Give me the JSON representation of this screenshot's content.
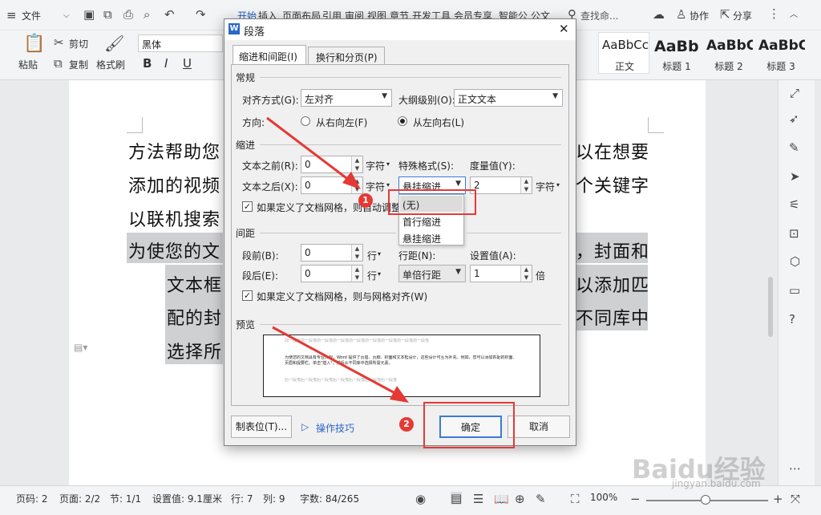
{
  "menubar": {
    "file": "文件",
    "tabs": [
      "开始",
      "插入",
      "页面布局",
      "引用",
      "审阅",
      "视图",
      "章节",
      "开发工具",
      "会员专享",
      "智能公",
      "公文"
    ],
    "search": "查找命...",
    "collab": "协作",
    "share": "分享"
  },
  "ribbon": {
    "paste": "粘贴",
    "cut": "剪切",
    "copy": "复制",
    "format_painter": "格式刷",
    "font_name": "黑体",
    "bold": "B",
    "italic": "I",
    "underline": "U",
    "styles": [
      {
        "preview": "AaBbCcDd",
        "name": "正文"
      },
      {
        "preview": "AaBb",
        "name": "标题 1"
      },
      {
        "preview": "AaBbC",
        "name": "标题 2"
      },
      {
        "preview": "AaBbC",
        "name": "标题 3"
      }
    ]
  },
  "document": {
    "lines": [
      {
        "left": "方法帮助您",
        "right": "以在想要"
      },
      {
        "left": "添加的视频",
        "right": "个关键字"
      },
      {
        "left": "以联机搜索",
        "right": ""
      },
      {
        "left": "为使您的文",
        "right": "，封面和"
      },
      {
        "left": "文本框",
        "right": "以添加匹"
      },
      {
        "left": "配的封",
        "right": "不同库中"
      },
      {
        "left": "选择所",
        "right": ""
      }
    ]
  },
  "dialog": {
    "title": "段落",
    "tabs": [
      "缩进和间距(I)",
      "换行和分页(P)"
    ],
    "general": {
      "section": "常规",
      "align_label": "对齐方式(G):",
      "align_value": "左对齐",
      "outline_label": "大纲级别(O):",
      "outline_value": "正文文本",
      "direction_label": "方向:",
      "rtl": "从右向左(F)",
      "ltr": "从左向右(L)"
    },
    "indent": {
      "section": "缩进",
      "before_label": "文本之前(R):",
      "before_value": "0",
      "after_label": "文本之后(X):",
      "after_value": "0",
      "unit": "字符",
      "special_label": "特殊格式(S):",
      "special_value": "悬挂缩进",
      "measure_label": "度量值(Y):",
      "measure_value": "2",
      "grid_check": "如果定义了文档网格，则自动调整右缩进(D)",
      "dropdown_options": [
        "(无)",
        "首行缩进",
        "悬挂缩进"
      ]
    },
    "spacing": {
      "section": "间距",
      "before_label": "段前(B):",
      "before_value": "0",
      "after_label": "段后(E):",
      "after_value": "0",
      "unit": "行",
      "line_label": "行距(N):",
      "line_value": "单倍行距",
      "setting_label": "设置值(A):",
      "setting_value": "1",
      "setting_unit": "倍",
      "grid_check": "如果定义了文档网格，则与网格对齐(W)"
    },
    "preview": {
      "section": "预览",
      "sample_prev": "前一段落前一段落前一段落前一段落前一段落前一段落前一段落前一段落前一段落",
      "sample_text": "为使您的文档具有专业外观，Word 提供了页眉、页脚、封面和文本框设计，这些设计可互为补充。例如，您可以添加匹配的封面、页眉和提要栏。单击\"插入\"，然后从不同库中选择所需元素。",
      "sample_next": "后一段落后一段落后一段落后一段落后一段落后一段落后一段落"
    },
    "tabs_button": "制表位(T)...",
    "tips": "操作技巧",
    "ok": "确定",
    "cancel": "取消",
    "markers": [
      "1",
      "2"
    ]
  },
  "status": {
    "page_num": "页码: 2",
    "pages": "页面: 2/2",
    "section": "节: 1/1",
    "setting": "设置值: 9.1厘米",
    "row": "行: 7",
    "col": "列: 9",
    "words": "字数: 84/265",
    "zoom": "100%"
  },
  "watermark": {
    "main": "Baidu经验",
    "sub": "jingyan.baidu.com"
  }
}
